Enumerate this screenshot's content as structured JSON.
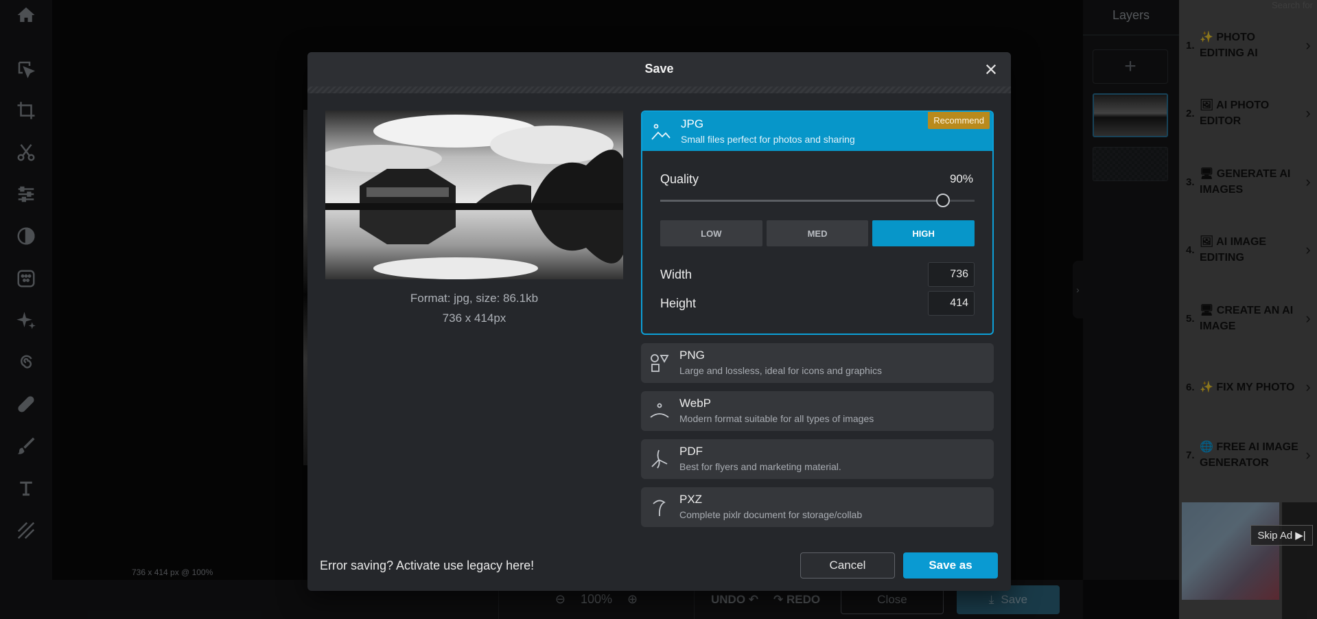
{
  "toolbar": {
    "tools": [
      "home-icon",
      "arrange-icon",
      "crop-icon",
      "cutout-icon",
      "adjust-icon",
      "filter-icon",
      "effect-icon",
      "ai-icon",
      "liquify-icon",
      "heal-icon",
      "draw-icon",
      "text-icon",
      "pattern-icon"
    ]
  },
  "canvas": {
    "status": "736 x 414 px @ 100%"
  },
  "bottombar": {
    "zoom": "100%",
    "undo": "UNDO",
    "redo": "REDO",
    "close": "Close",
    "save": "Save"
  },
  "layers": {
    "title": "Layers",
    "add": "+"
  },
  "ad_sidebar": {
    "search": "Search for",
    "items": [
      {
        "num": "1.",
        "icon": "✨",
        "label": "PHOTO EDITING AI"
      },
      {
        "num": "2.",
        "icon": "🖼",
        "label": "AI PHOTO EDITOR"
      },
      {
        "num": "3.",
        "icon": "🖥",
        "label": "GENERATE AI IMAGES"
      },
      {
        "num": "4.",
        "icon": "🖼",
        "label": "AI IMAGE EDITING"
      },
      {
        "num": "5.",
        "icon": "🖥",
        "label": "CREATE AN AI IMAGE"
      },
      {
        "num": "6.",
        "icon": "✨",
        "label": "FIX MY PHOTO"
      },
      {
        "num": "7.",
        "icon": "🌐",
        "label": "FREE AI IMAGE GENERATOR"
      }
    ],
    "skip_ad": "Skip Ad"
  },
  "modal": {
    "title": "Save",
    "preview": {
      "format_line": "Format: jpg, size: 86.1kb",
      "size_line": "736 x 414px"
    },
    "selected_format": {
      "name": "JPG",
      "desc": "Small files perfect for photos and sharing",
      "badge": "Recommend",
      "quality_label": "Quality",
      "quality_value": "90%",
      "quality_fraction": 0.9,
      "quality_buttons": [
        "LOW",
        "MED",
        "HIGH"
      ],
      "active_quality": "HIGH",
      "width_label": "Width",
      "width_value": "736",
      "height_label": "Height",
      "height_value": "414"
    },
    "other_formats": [
      {
        "name": "PNG",
        "desc": "Large and lossless, ideal for icons and graphics"
      },
      {
        "name": "WebP",
        "desc": "Modern format suitable for all types of images"
      },
      {
        "name": "PDF",
        "desc": "Best for flyers and marketing material."
      },
      {
        "name": "PXZ",
        "desc": "Complete pixlr document for storage/collab"
      }
    ],
    "legacy": "Error saving? Activate use legacy here!",
    "cancel": "Cancel",
    "save_as": "Save as"
  },
  "colors": {
    "accent": "#0796c9",
    "badge": "#b98a1c",
    "modal_bg": "#25272b"
  }
}
